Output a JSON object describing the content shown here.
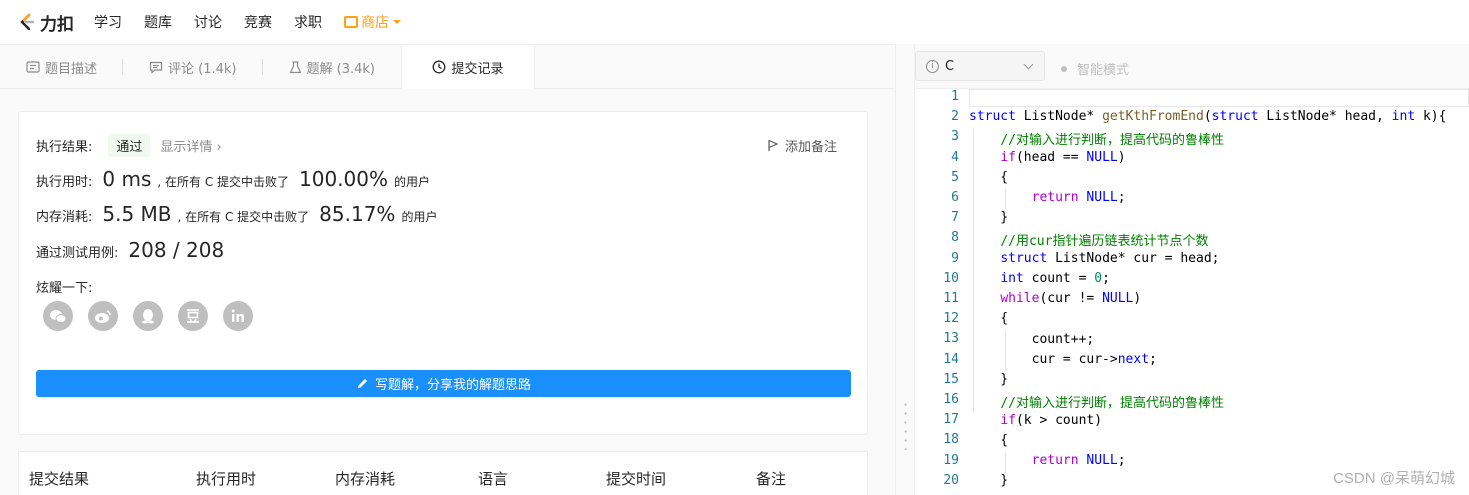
{
  "nav": {
    "logo_text": "力扣",
    "links": [
      "学习",
      "题库",
      "讨论",
      "竞赛",
      "求职"
    ],
    "store": "商店"
  },
  "tabs": [
    {
      "label": "题目描述",
      "icon": "document-icon"
    },
    {
      "label": "评论 (1.4k)",
      "icon": "comment-icon"
    },
    {
      "label": "题解 (3.4k)",
      "icon": "flask-icon"
    },
    {
      "label": "提交记录",
      "icon": "clock-icon"
    }
  ],
  "result": {
    "status_label": "执行结果:",
    "status_value": "通过",
    "detail_link": "显示详情 ›",
    "add_note": "添加备注",
    "time_label": "执行用时:",
    "time_value": "0 ms",
    "time_mid": ", 在所有 C 提交中击败了",
    "time_percent": "100.00%",
    "time_tail": "的用户",
    "mem_label": "内存消耗:",
    "mem_value": "5.5 MB",
    "mem_mid": ", 在所有 C 提交中击败了",
    "mem_percent": "85.17%",
    "mem_tail": "的用户",
    "tests_label": "通过测试用例:",
    "tests_value": "208 / 208",
    "share_label": "炫耀一下:",
    "socials": [
      "wechat-icon",
      "weibo-icon",
      "qq-icon",
      "douban-icon",
      "linkedin-icon"
    ],
    "write_button": "写题解，分享我的解题思路"
  },
  "table": {
    "headers": [
      "提交结果",
      "执行用时",
      "内存消耗",
      "语言",
      "提交时间",
      "备注"
    ]
  },
  "editor": {
    "language": "C",
    "smart_mode": "智能模式",
    "line_numbers": [
      "1",
      "2",
      "3",
      "4",
      "5",
      "6",
      "7",
      "8",
      "9",
      "10",
      "11",
      "12",
      "13",
      "14",
      "15",
      "16",
      "17",
      "18",
      "19",
      "20"
    ]
  },
  "watermark": "CSDN @呆萌幻城"
}
